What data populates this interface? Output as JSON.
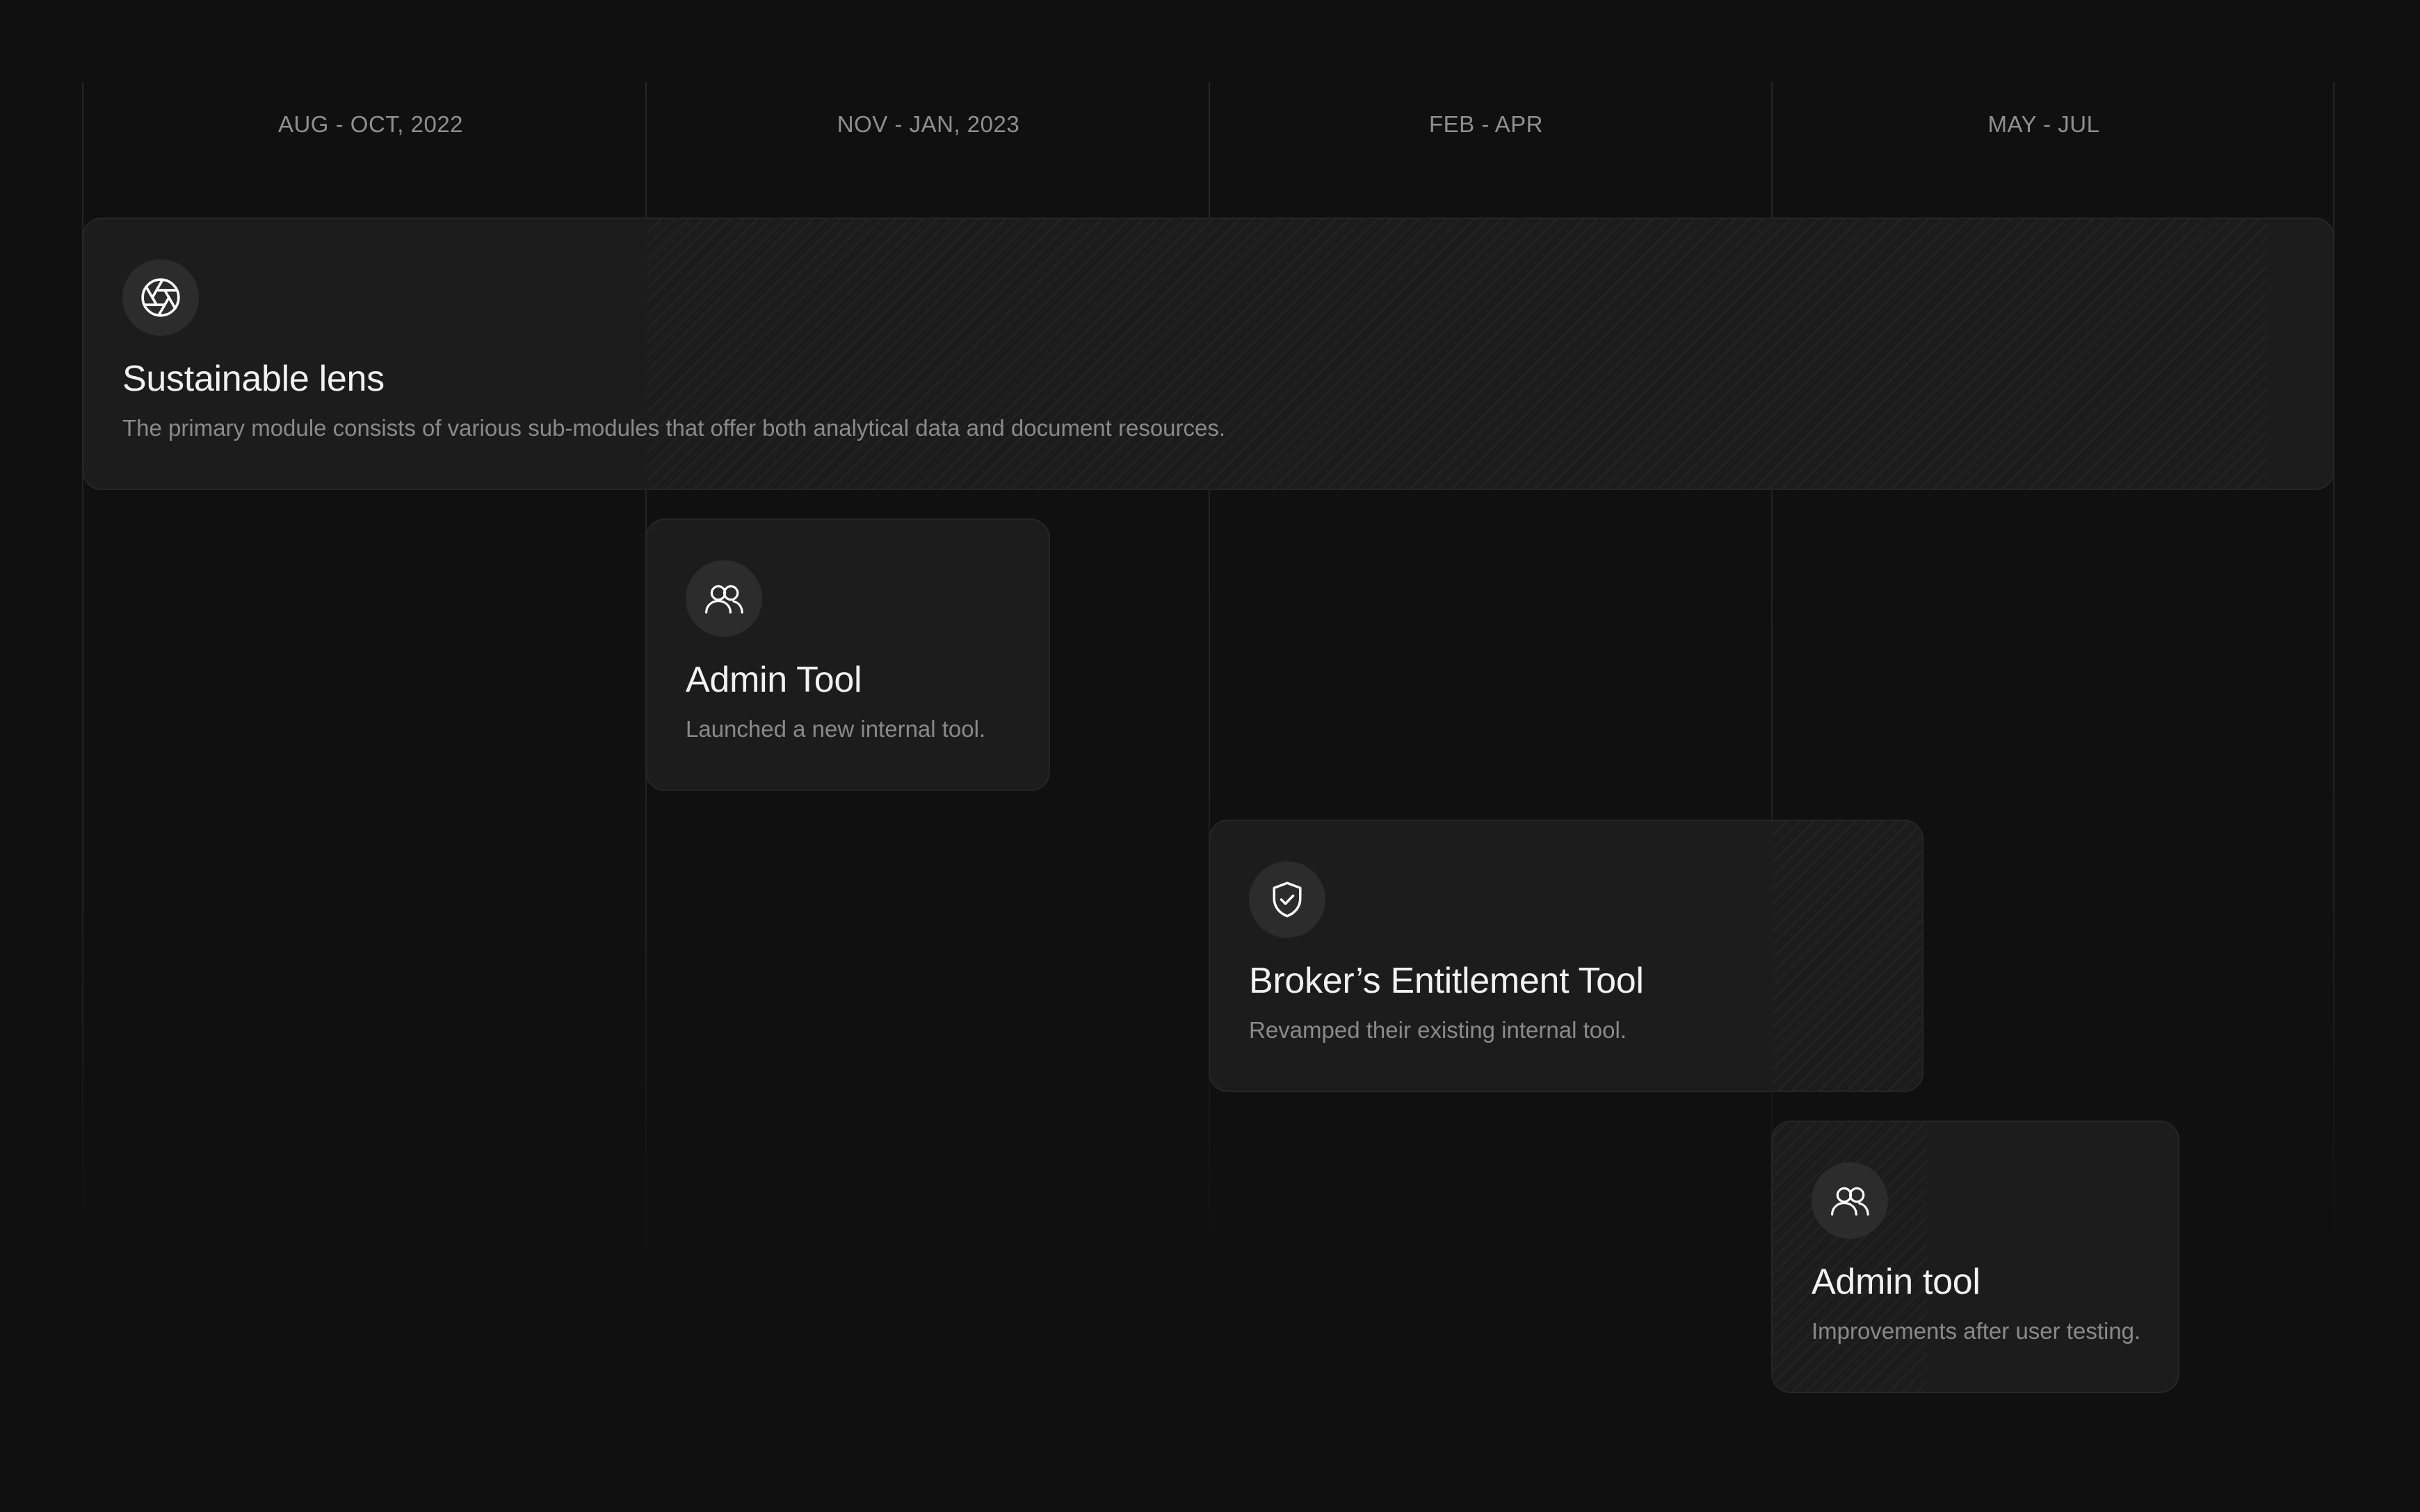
{
  "timeline": {
    "columns": [
      {
        "label": "AUG - OCT, 2022"
      },
      {
        "label": "NOV - JAN, 2023"
      },
      {
        "label": "FEB - APR"
      },
      {
        "label": "MAY - JUL"
      }
    ]
  },
  "cards": [
    {
      "icon": "aperture-icon",
      "title": "Sustainable lens",
      "description": "The primary module consists of various sub-modules that offer both analytical data and document resources."
    },
    {
      "icon": "users-icon",
      "title": "Admin Tool",
      "description": "Launched a new internal tool."
    },
    {
      "icon": "shield-check-icon",
      "title": "Broker’s Entitlement Tool",
      "description": "Revamped their existing internal tool."
    },
    {
      "icon": "users-icon",
      "title": "Admin tool",
      "description": "Improvements after user testing."
    }
  ],
  "colors": {
    "background": "#101010",
    "card": "#1c1c1c",
    "card_border": "#262626",
    "icon_circle": "#2c2c2c",
    "title": "#f2f2f2",
    "muted_text": "#8a8a8a"
  }
}
